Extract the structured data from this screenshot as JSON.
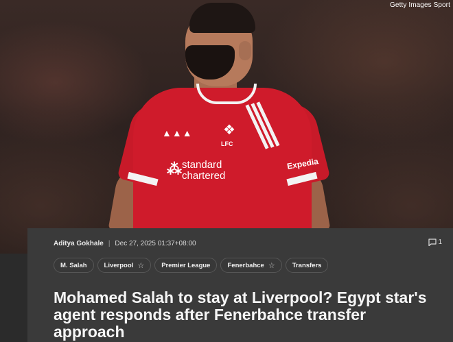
{
  "photo": {
    "credit": "Getty Images Sport",
    "sponsor_line1": "standard",
    "sponsor_line2": "chartered",
    "club_initials": "LFC",
    "sleeve_sponsor": "Expedia"
  },
  "article": {
    "author": "Aditya Gokhale",
    "separator": "|",
    "timestamp": "Dec 27, 2025 01:37+08:00",
    "comment_count": "1",
    "tags": [
      {
        "label": "M. Salah",
        "followable": false
      },
      {
        "label": "Liverpool",
        "followable": true
      },
      {
        "label": "Premier League",
        "followable": false
      },
      {
        "label": "Fenerbahce",
        "followable": true
      },
      {
        "label": "Transfers",
        "followable": false
      }
    ],
    "headline": "Mohamed Salah to stay at Liverpool? Egypt star's agent responds after Fenerbahce transfer approach"
  },
  "icons": {
    "comment": "comment-icon",
    "follow": "star-icon"
  },
  "colors": {
    "card_background": "#3a3a3a",
    "page_background": "#2b2b2b",
    "jersey_red": "#cf1b2b"
  }
}
